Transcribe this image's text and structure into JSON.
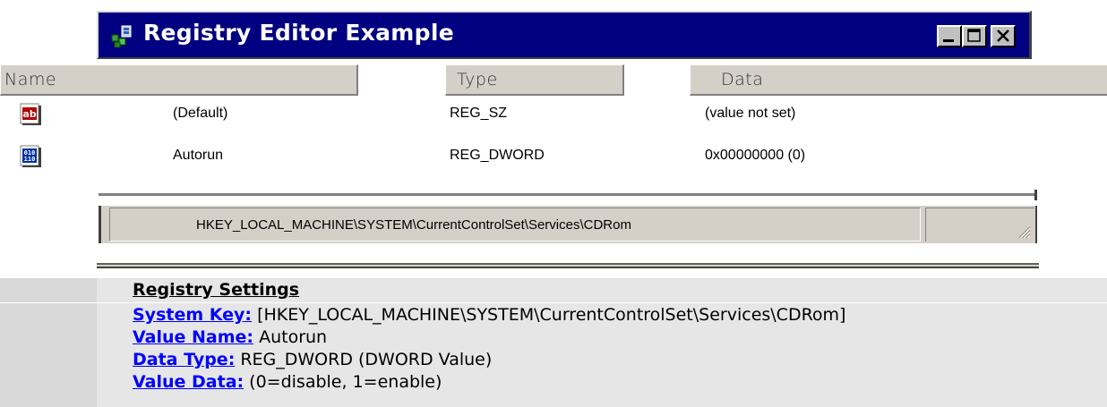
{
  "window": {
    "title": "Registry Editor Example",
    "icons": {
      "app": "registry-editor-icon",
      "minimize": "minimize-icon",
      "maximize": "maximize-icon",
      "close": "close-icon"
    },
    "colors": {
      "titlebar": "#000080",
      "chrome": "#c0c0c0"
    }
  },
  "columns": {
    "name": "Name",
    "type": "Type",
    "data": "Data"
  },
  "values": [
    {
      "icon": "string-value-icon",
      "name": "(Default)",
      "type": "REG_SZ",
      "data": "(value not set)"
    },
    {
      "icon": "binary-value-icon",
      "name": "Autorun",
      "type": "REG_DWORD",
      "data": "0x00000000 (0)"
    }
  ],
  "status_bar": {
    "path": "HKEY_LOCAL_MACHINE\\SYSTEM\\CurrentControlSet\\Services\\CDRom"
  },
  "registry_settings": {
    "title": "Registry Settings",
    "lines": [
      {
        "label": "System Key:",
        "value": " [HKEY_LOCAL_MACHINE\\SYSTEM\\CurrentControlSet\\Services\\CDRom]"
      },
      {
        "label": "Value Name:",
        "value": " Autorun"
      },
      {
        "label": "Data Type:",
        "value": " REG_DWORD (DWORD Value)"
      },
      {
        "label": "Value Data:",
        "value": " (0=disable, 1=enable)"
      }
    ],
    "colors": {
      "link": "#0000ff",
      "background": "#e6e6e6"
    }
  }
}
